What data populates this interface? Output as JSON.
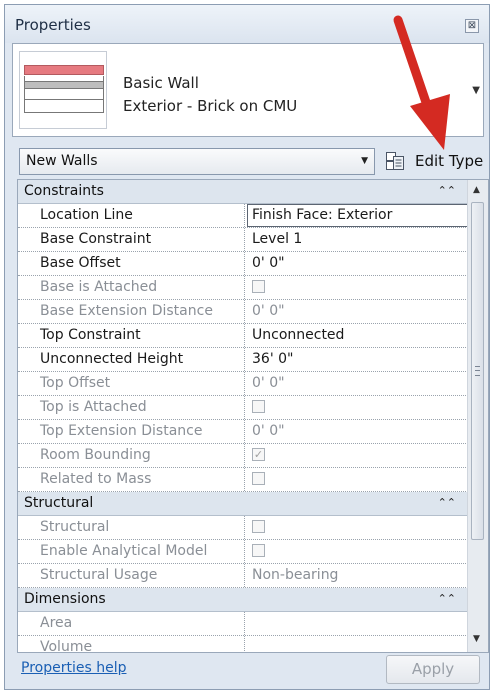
{
  "window": {
    "title": "Properties",
    "close_glyph": "⊠"
  },
  "type_selector": {
    "family": "Basic Wall",
    "type_name": "Exterior - Brick on CMU"
  },
  "filter": {
    "selected": "New Walls",
    "edit_type_label": "Edit Type"
  },
  "groups": {
    "constraints": {
      "label": "Constraints",
      "chevron": "⌃⌃"
    },
    "structural": {
      "label": "Structural",
      "chevron": "⌃⌃"
    },
    "dimensions": {
      "label": "Dimensions",
      "chevron": "⌃⌃"
    }
  },
  "constraints": {
    "location_line": {
      "label": "Location Line",
      "value": "Finish Face: Exterior"
    },
    "base_constraint": {
      "label": "Base Constraint",
      "value": "Level 1"
    },
    "base_offset": {
      "label": "Base Offset",
      "value": "0'  0\""
    },
    "base_is_attached": {
      "label": "Base is Attached",
      "checked": false
    },
    "base_extension": {
      "label": "Base Extension Distance",
      "value": "0'  0\""
    },
    "top_constraint": {
      "label": "Top Constraint",
      "value": "Unconnected"
    },
    "unconnected_height": {
      "label": "Unconnected Height",
      "value": "36'  0\""
    },
    "top_offset": {
      "label": "Top Offset",
      "value": "0'  0\""
    },
    "top_is_attached": {
      "label": "Top is Attached",
      "checked": false
    },
    "top_extension": {
      "label": "Top Extension Distance",
      "value": "0'  0\""
    },
    "room_bounding": {
      "label": "Room Bounding",
      "checked": true,
      "check_glyph": "✓"
    },
    "related_to_mass": {
      "label": "Related to Mass",
      "checked": false
    }
  },
  "structural": {
    "structural": {
      "label": "Structural",
      "checked": false
    },
    "enable_analytical": {
      "label": "Enable Analytical Model",
      "checked": false
    },
    "structural_usage": {
      "label": "Structural Usage",
      "value": "Non-bearing"
    }
  },
  "dimensions": {
    "area": {
      "label": "Area",
      "value": ""
    },
    "volume": {
      "label": "Volume",
      "value": ""
    }
  },
  "footer": {
    "help_link": "Properties help",
    "apply_label": "Apply"
  },
  "icons": [
    "close-icon",
    "wall-type-thumbnail",
    "dropdown-arrow-icon",
    "edit-type-icon",
    "collapse-chevron-icon",
    "checkbox-icon",
    "scroll-up-icon",
    "scroll-down-icon",
    "red-arrow-annotation"
  ],
  "colors": {
    "annotation_arrow": "#d42a22",
    "panel_bg": "#dfe7f1",
    "group_header_bg": "#dde5ee",
    "link": "#1a5fb4",
    "wall_brick": "#e67a80"
  }
}
